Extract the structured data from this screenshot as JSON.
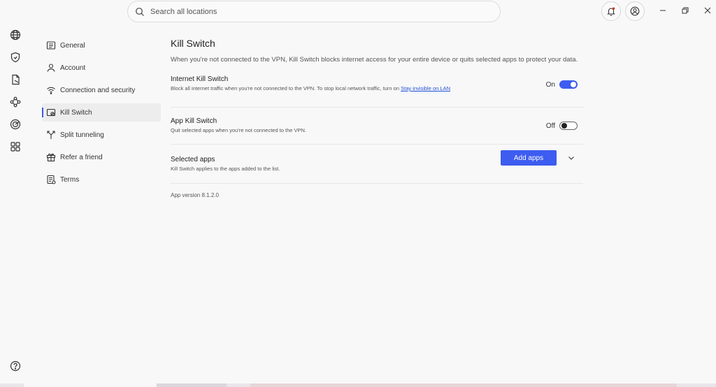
{
  "search": {
    "placeholder": "Search all locations"
  },
  "rail": {
    "icons": [
      "globe-icon",
      "shield-icon",
      "file-export-icon",
      "mesh-network-icon",
      "radar-icon",
      "apps-grid-icon",
      "help-icon"
    ]
  },
  "nav": {
    "items": [
      {
        "label": "General",
        "icon": "general-settings-icon"
      },
      {
        "label": "Account",
        "icon": "account-icon"
      },
      {
        "label": "Connection and security",
        "icon": "wifi-icon"
      },
      {
        "label": "Kill Switch",
        "icon": "kill-switch-icon",
        "active": true
      },
      {
        "label": "Split tunneling",
        "icon": "split-tunnel-icon"
      },
      {
        "label": "Refer a friend",
        "icon": "gift-icon"
      },
      {
        "label": "Terms",
        "icon": "terms-icon"
      }
    ]
  },
  "page": {
    "title": "Kill Switch",
    "description": "When you're not connected to the VPN, Kill Switch blocks internet access for your entire device or quits selected apps to protect your data."
  },
  "settings": {
    "internet": {
      "label": "Internet Kill Switch",
      "sub": "Block all internet traffic when you're not connected to the VPN. To stop local network traffic, turn on",
      "link": "Stay invisible on LAN",
      "state": "On"
    },
    "app": {
      "label": "App Kill Switch",
      "sub": "Quit selected apps when you're not connected to the VPN.",
      "state": "Off"
    },
    "selected": {
      "label": "Selected apps",
      "sub": "Kill Switch applies to the apps added to the list.",
      "button": "Add apps"
    }
  },
  "footer": {
    "version": "App version 8.1.2.0"
  },
  "colors": {
    "accent": "#3d5cf0",
    "background": "#f8f8f8",
    "link": "#1f4fd6"
  }
}
